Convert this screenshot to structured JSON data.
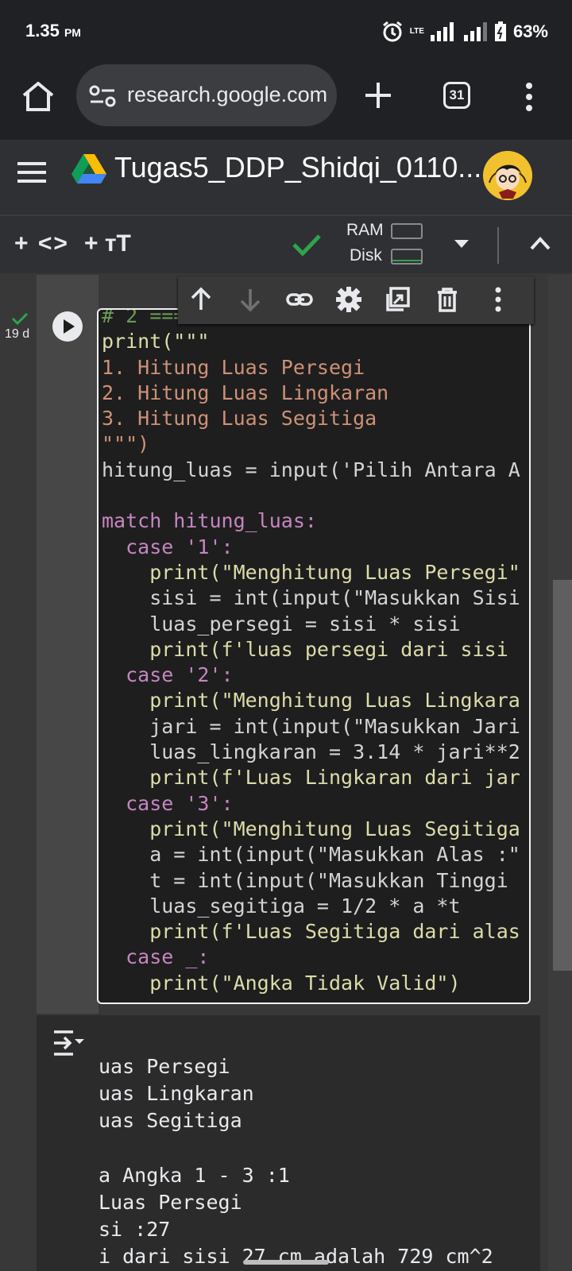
{
  "status_bar": {
    "time": "1.35",
    "ampm": "PM",
    "network": "LTE",
    "battery": "63%"
  },
  "browser": {
    "url": "research.google.com",
    "tab_count": "31"
  },
  "colab": {
    "title": "Tugas5_DDP_Shidqi_0110...",
    "toolbar": {
      "add_code": "+ <>",
      "add_text": "+ тT",
      "ram_label": "RAM",
      "disk_label": "Disk"
    },
    "cell": {
      "exec_time": "19 d"
    },
    "icons": {
      "move_up": "arrow-up-icon",
      "move_down": "arrow-down-icon",
      "link": "link-icon",
      "settings": "gear-icon",
      "mirror": "mirror-cell-icon",
      "delete": "trash-icon",
      "more": "more-vert-icon"
    }
  },
  "code_lines": [
    "# 2 === Match Case",
    "print(\"\"\"",
    "1. Hitung Luas Persegi",
    "2. Hitung Luas Lingkaran",
    "3. Hitung Luas Segitiga",
    "\"\"\")",
    "hitung_luas = input('Pilih Antara A",
    "",
    "match hitung_luas:",
    "  case '1':",
    "    print(\"Menghitung Luas Persegi\"",
    "    sisi = int(input(\"Masukkan Sisi",
    "    luas_persegi = sisi * sisi",
    "    print(f'luas persegi dari sisi",
    "  case '2':",
    "    print(\"Menghitung Luas Lingkara",
    "    jari = int(input(\"Masukkan Jari",
    "    luas_lingkaran = 3.14 * jari**2",
    "    print(f'Luas Lingkaran dari jar",
    "  case '3':",
    "    print(\"Menghitung Luas Segitiga",
    "    a = int(input(\"Masukkan Alas :\"",
    "    t = int(input(\"Masukkan Tinggi",
    "    luas_segitiga = 1/2 * a *t",
    "    print(f'Luas Segitiga dari alas",
    "  case _:",
    "    print(\"Angka Tidak Valid\")"
  ],
  "output_lines": [
    "uas Persegi",
    "uas Lingkaran",
    "uas Segitiga",
    "",
    "a Angka 1 - 3 :1",
    "Luas Persegi",
    "si :27",
    "i dari sisi 27 cm adalah 729 cm^2"
  ],
  "colors": {
    "accent_green": "#2da44e",
    "editor_bg": "#1e1e1e",
    "comment": "#6a9955",
    "keyword": "#c586c0",
    "function": "#dcdcaa",
    "string": "#ce9178",
    "builtin": "#4ec9b0"
  }
}
